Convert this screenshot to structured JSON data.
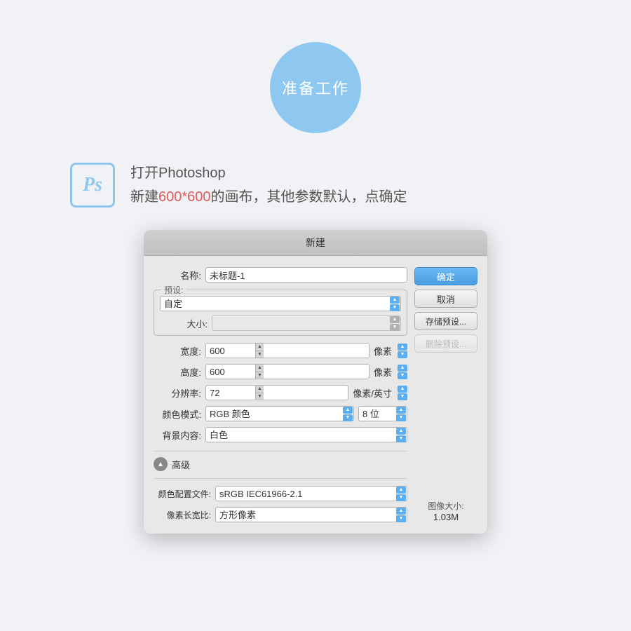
{
  "badge": {
    "label": "准备工作"
  },
  "instruction": {
    "ps_icon": "Ps",
    "line1": "打开Photoshop",
    "line2_prefix": "新建",
    "line2_highlight": "600*600",
    "line2_suffix": "的画布，其他参数默认，点确定"
  },
  "dialog": {
    "title": "新建",
    "fields": {
      "name_label": "名称:",
      "name_value": "未标题-1",
      "preset_label": "预设:",
      "preset_value": "自定",
      "size_label": "大小:",
      "size_value": "",
      "width_label": "宽度:",
      "width_value": "600",
      "width_unit": "像素",
      "height_label": "高度:",
      "height_value": "600",
      "height_unit": "像素",
      "resolution_label": "分辨率:",
      "resolution_value": "72",
      "resolution_unit": "像素/英寸",
      "color_mode_label": "颜色模式:",
      "color_mode_value": "RGB 颜色",
      "color_bits_value": "8 位",
      "bg_content_label": "背景内容:",
      "bg_content_value": "白色",
      "advanced_label": "高级",
      "color_profile_label": "颜色配置文件:",
      "color_profile_value": "sRGB IEC61966-2.1",
      "pixel_ratio_label": "像素长宽比:",
      "pixel_ratio_value": "方形像素"
    },
    "buttons": {
      "ok": "确定",
      "cancel": "取消",
      "save_preset": "存储预设...",
      "delete_preset": "删除预设..."
    },
    "image_size": {
      "label": "图像大小:",
      "value": "1.03M"
    }
  }
}
